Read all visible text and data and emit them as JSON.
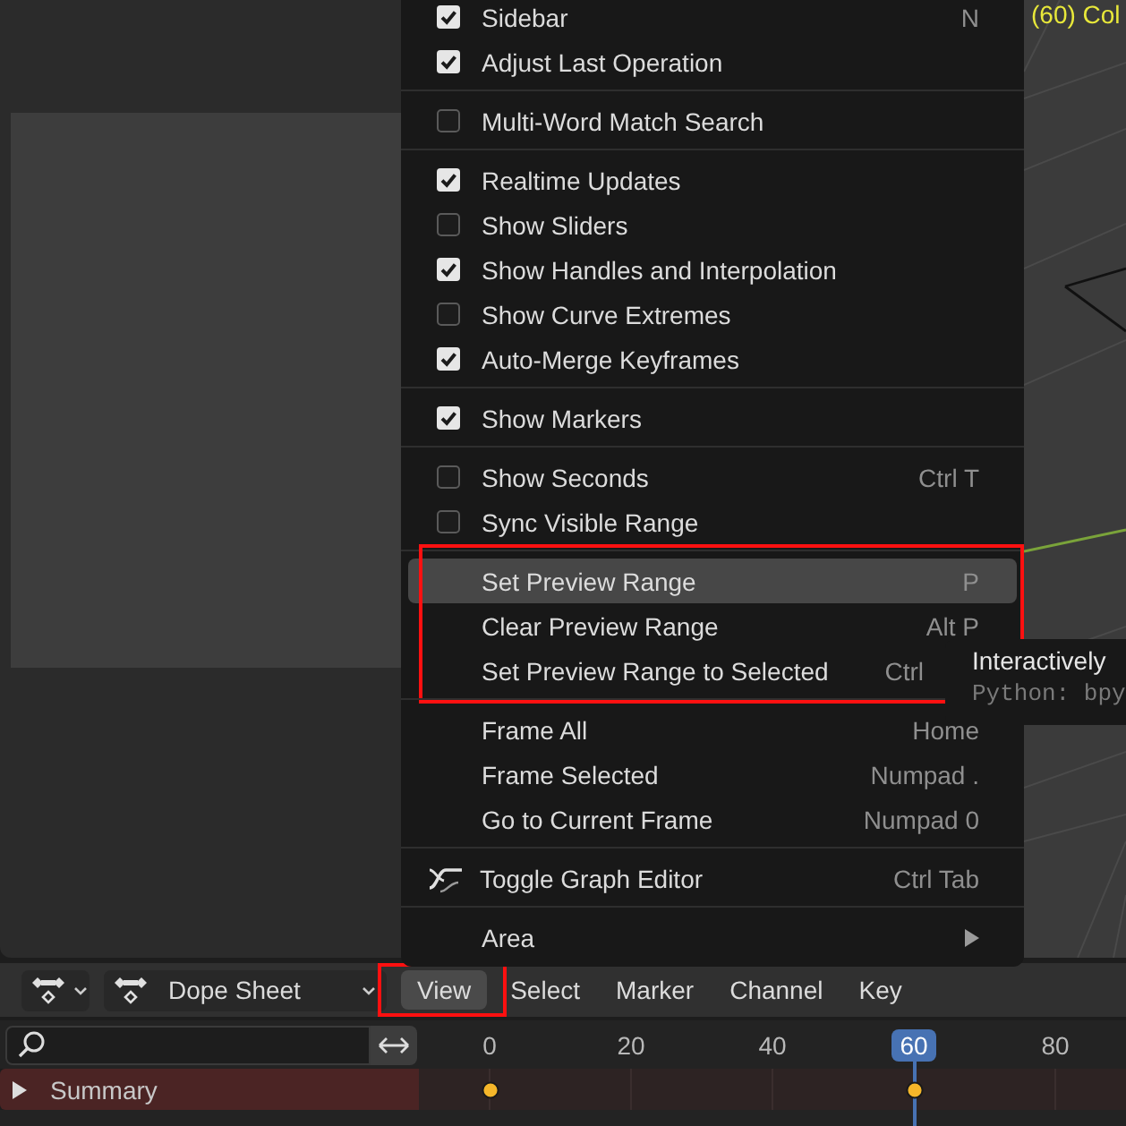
{
  "viewport": {
    "overlay_text": "(60) Col"
  },
  "menu": {
    "sections": [
      {
        "highlighted": false,
        "items": [
          {
            "kind": "check",
            "label": "Sidebar",
            "checked": true,
            "shortcut": "N",
            "selected": false
          },
          {
            "kind": "check",
            "label": "Adjust Last Operation",
            "checked": true,
            "selected": false
          }
        ]
      },
      {
        "highlighted": false,
        "items": [
          {
            "kind": "check",
            "label": "Multi-Word Match Search",
            "checked": false,
            "selected": false
          }
        ]
      },
      {
        "highlighted": false,
        "items": [
          {
            "kind": "check",
            "label": "Realtime Updates",
            "checked": true,
            "selected": false
          },
          {
            "kind": "check",
            "label": "Show Sliders",
            "checked": false,
            "selected": false
          },
          {
            "kind": "check",
            "label": "Show Handles and Interpolation",
            "checked": true,
            "selected": false
          },
          {
            "kind": "check",
            "label": "Show Curve Extremes",
            "checked": false,
            "selected": false
          },
          {
            "kind": "check",
            "label": "Auto-Merge Keyframes",
            "checked": true,
            "selected": false
          }
        ]
      },
      {
        "highlighted": false,
        "items": [
          {
            "kind": "check",
            "label": "Show Markers",
            "checked": true,
            "selected": false
          }
        ]
      },
      {
        "highlighted": false,
        "items": [
          {
            "kind": "check",
            "label": "Show Seconds",
            "checked": false,
            "shortcut": "Ctrl T",
            "selected": false
          },
          {
            "kind": "check",
            "label": "Sync Visible Range",
            "checked": false,
            "selected": false
          }
        ]
      },
      {
        "highlighted": true,
        "items": [
          {
            "kind": "action",
            "label": "Set Preview Range",
            "shortcut": "P",
            "selected": true
          },
          {
            "kind": "action",
            "label": "Clear Preview Range",
            "shortcut": "Alt P",
            "selected": false
          },
          {
            "kind": "action",
            "label": "Set Preview Range to Selected",
            "shortcut": "Ctrl",
            "shortcut_cut": true,
            "selected": false
          }
        ]
      },
      {
        "highlighted": false,
        "items": [
          {
            "kind": "action",
            "label": "Frame All",
            "shortcut": "Home",
            "selected": false
          },
          {
            "kind": "action",
            "label": "Frame Selected",
            "shortcut": "Numpad .",
            "selected": false
          },
          {
            "kind": "action",
            "label": "Go to Current Frame",
            "shortcut": "Numpad 0",
            "selected": false
          }
        ]
      },
      {
        "highlighted": false,
        "items": [
          {
            "kind": "graph",
            "label": "Toggle Graph Editor",
            "shortcut": "Ctrl Tab",
            "selected": false
          }
        ]
      },
      {
        "highlighted": false,
        "items": [
          {
            "kind": "submenu",
            "label": "Area",
            "selected": false
          }
        ]
      }
    ]
  },
  "tooltip": {
    "title": "Interactively",
    "python": "Python: bpy"
  },
  "header": {
    "editor": "Dope Sheet",
    "menus": [
      {
        "label": "View",
        "selected": true,
        "highlighted": true
      },
      {
        "label": "Select",
        "selected": false,
        "highlighted": false
      },
      {
        "label": "Marker",
        "selected": false,
        "highlighted": false
      },
      {
        "label": "Channel",
        "selected": false,
        "highlighted": false
      },
      {
        "label": "Key",
        "selected": false,
        "highlighted": false
      }
    ]
  },
  "timeline": {
    "frames": [
      {
        "label": "0",
        "current": false,
        "keyframe": true
      },
      {
        "label": "20",
        "current": false,
        "keyframe": false
      },
      {
        "label": "40",
        "current": false,
        "keyframe": false
      },
      {
        "label": "60",
        "current": true,
        "keyframe": true
      },
      {
        "label": "80",
        "current": false,
        "keyframe": false
      }
    ],
    "channels": [
      {
        "name": "Summary",
        "expanded": false
      }
    ]
  }
}
